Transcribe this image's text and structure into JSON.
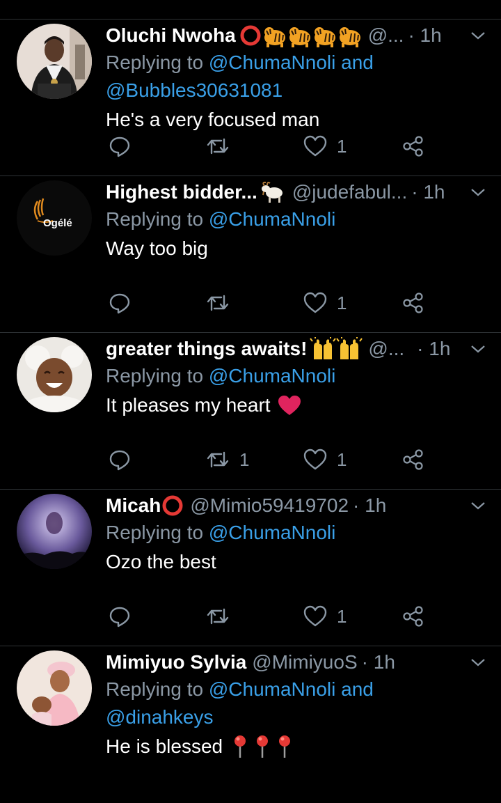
{
  "tweets": [
    {
      "name": "Oluchi Nwoha",
      "handle": "@...",
      "time": "· 1h",
      "reply_prefix": "Replying to ",
      "reply_mentions": "@ChumaNnoli and",
      "reply_mentions_2": "@Bubbles30631081",
      "text": "He's a very focused man",
      "retweets": "",
      "likes": "1",
      "name_emoji": [
        "hollow-red-circle-emoji",
        "tiger-emoji",
        "tiger-emoji",
        "tiger-emoji",
        "tiger-emoji"
      ]
    },
    {
      "name": "Highest bidder...",
      "handle": "@judefabul...",
      "time": "· 1h",
      "reply_prefix": "Replying to ",
      "reply_mentions": "@ChumaNnoli",
      "text": "Way too big",
      "retweets": "",
      "likes": "1",
      "avatar_logo": "Ogélé",
      "name_emoji": [
        "goat-emoji"
      ]
    },
    {
      "name": "greater things awaits!",
      "handle": "@...",
      "time": "· 1h",
      "reply_prefix": "Replying to ",
      "reply_mentions": "@ChumaNnoli",
      "text": "It pleases my heart",
      "retweets": "1",
      "likes": "1",
      "name_emoji": [
        "raising-hands-emoji",
        "raising-hands-emoji"
      ],
      "text_emoji": [
        "red-heart-emoji"
      ]
    },
    {
      "name": "Micah",
      "handle": "@Mimio59419702",
      "time": "· 1h",
      "reply_prefix": "Replying to ",
      "reply_mentions": "@ChumaNnoli",
      "text": "Ozo the best",
      "retweets": "",
      "likes": "1",
      "name_emoji": [
        "hollow-red-circle-emoji"
      ]
    },
    {
      "name": "Mimiyuo Sylvia",
      "handle": "@MimiyuoS",
      "time": "· 1h",
      "reply_prefix": "Replying to ",
      "reply_mentions": "@ChumaNnoli and",
      "reply_mentions_2": "@dinahkeys",
      "text": "He is blessed",
      "text_emoji": [
        "round-pushpin-emoji",
        "round-pushpin-emoji",
        "round-pushpin-emoji"
      ]
    }
  ],
  "colors": {
    "background": "#000000",
    "secondary_text": "#8b98a5",
    "mention": "#3aa0e8",
    "divider": "#2f3336",
    "heart_emoji": "#e0245e"
  }
}
